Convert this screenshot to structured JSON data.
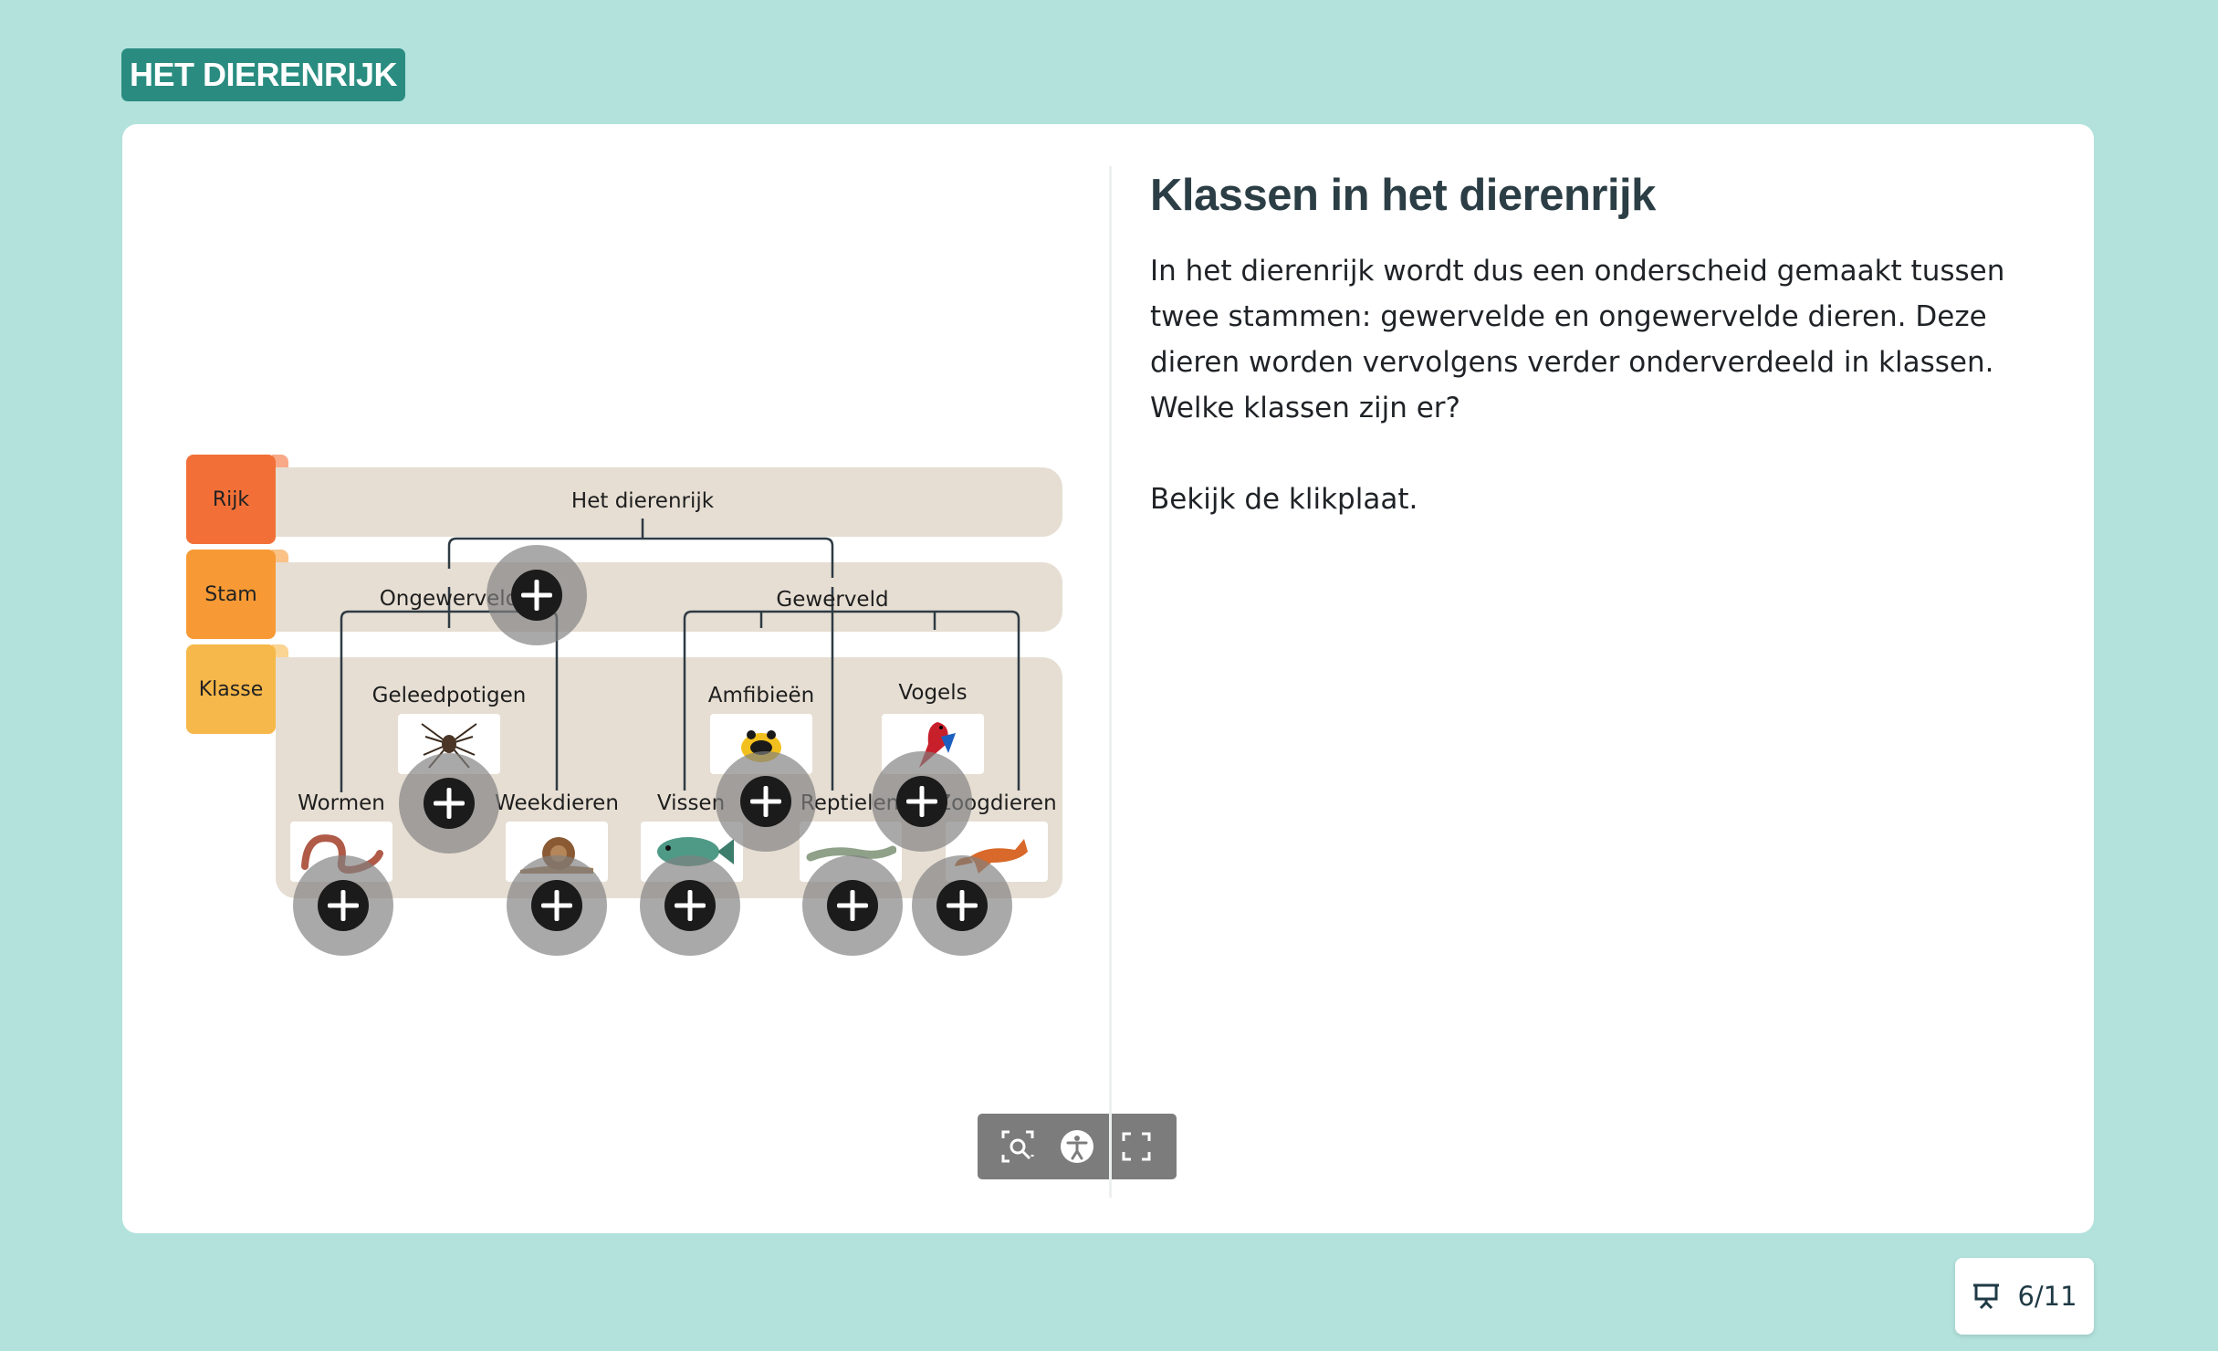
{
  "brand": "HET DIERENRIJK",
  "content": {
    "heading": "Klassen in het dierenrijk",
    "paragraphs": [
      "In het dierenrijk wordt dus een onderscheid gemaakt tussen twee stammen: gewervelde en ongewervelde dieren. Deze dieren worden vervolgens verder onderverdeeld in klassen. Welke klassen zijn er?",
      "Bekijk de klikplaat."
    ]
  },
  "diagram": {
    "levels": {
      "rijk": "Rijk",
      "stam": "Stam",
      "klasse": "Klasse"
    },
    "colors": {
      "rijk": "#f27038",
      "stam": "#f79a35",
      "klasse": "#f6b84a",
      "band": "#e6ded3"
    },
    "nodes": {
      "root": "Het dierenrijk",
      "invertebrates": "Ongewerveld",
      "vertebrates": "Gewerveld",
      "arthropods": "Geleedpotigen",
      "worms": "Wormen",
      "molluscs": "Weekdieren",
      "amphibians": "Amfibieën",
      "birds": "Vogels",
      "fish": "Vissen",
      "reptiles": "Reptielen",
      "mammals": "Zoogdieren"
    }
  },
  "toolbar": {
    "icons": [
      "zoom-select-icon",
      "accessibility-icon",
      "fullscreen-icon"
    ]
  },
  "pager": {
    "label": "6/11",
    "icon": "presentation-icon"
  }
}
